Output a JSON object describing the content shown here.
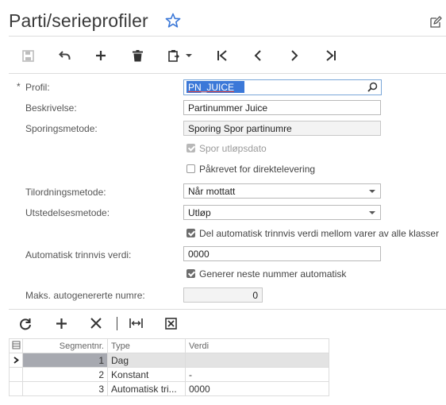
{
  "header": {
    "title": "Parti/serieprofiler"
  },
  "icons": {
    "favorite": "star-icon",
    "edit": "edit-icon",
    "toolbar": [
      "save-icon",
      "undo-icon",
      "add-icon",
      "delete-icon",
      "copy-paste-icon",
      "first-icon",
      "previous-icon",
      "next-icon",
      "last-icon"
    ]
  },
  "form": {
    "required_marker": "*",
    "profil_label": "Profil:",
    "profil_value": "PN_JUICE",
    "beskrivelse_label": "Beskrivelse:",
    "beskrivelse_value": "Partinummer Juice",
    "sporingsmetode_label": "Sporingsmetode:",
    "sporingsmetode_value": "Sporing Spor partinumre",
    "spor_utlopsdato": "Spor utløpsdato",
    "pakrevet": "Påkrevet for direktelevering",
    "tilordningsmetode_label": "Tilordningsmetode:",
    "tilordningsmetode_value": "Når mottatt",
    "utstedelsesmetode_label": "Utstedelsesmetode:",
    "utstedelsesmetode_value": "Utløp",
    "del_automatisk": "Del automatisk trinnvis verdi mellom varer av alle klasser",
    "automatisk_label": "Automatisk trinnvis verdi:",
    "automatisk_value": "0000",
    "generer_neste": "Generer neste nummer automatisk",
    "maks_label": "Maks. autogenererte numre:",
    "maks_value": "0"
  },
  "grid": {
    "headers": {
      "segment": "Segmentnr.",
      "type": "Type",
      "verdi": "Verdi"
    },
    "rows": [
      {
        "segment": "1",
        "type": "Dag",
        "verdi": ""
      },
      {
        "segment": "2",
        "type": "Konstant",
        "verdi": "-"
      },
      {
        "segment": "3",
        "type": "Automatisk tri...",
        "verdi": "0000"
      }
    ]
  }
}
